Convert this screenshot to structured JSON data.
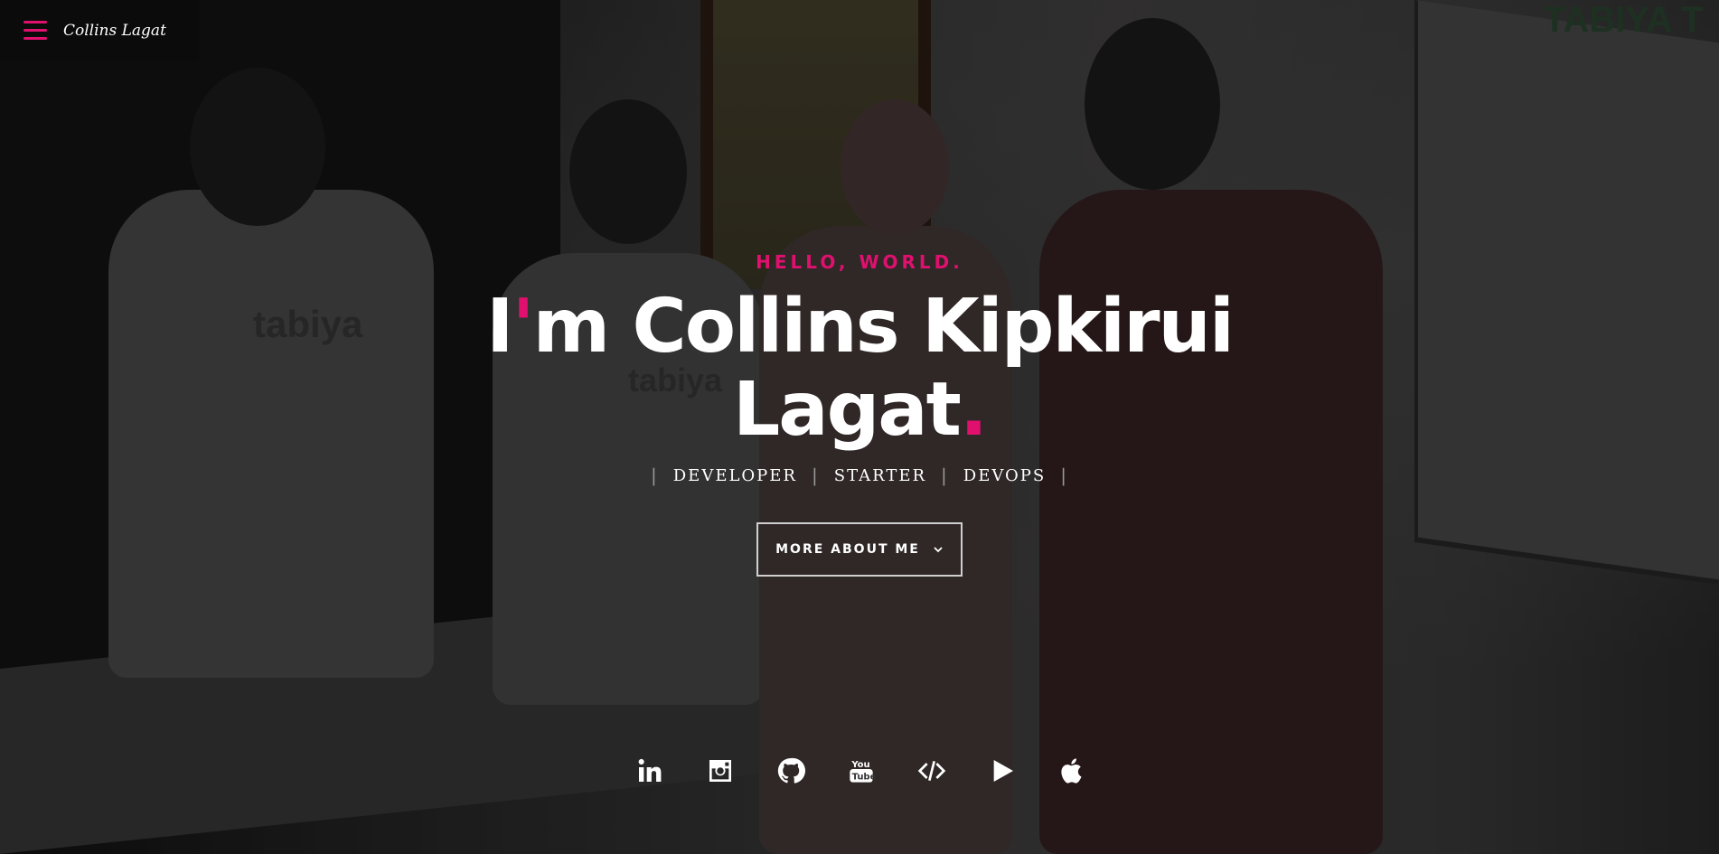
{
  "header": {
    "site_name": "Collins Lagat",
    "menu_icon": "hamburger-menu-icon",
    "accent_color": "#e0106f"
  },
  "hero": {
    "kicker": "HELLO, WORLD.",
    "title_apostrophe_prefix": "I",
    "title_apostrophe": "'",
    "title_rest": "m Collins Kipkirui Lagat",
    "title_dot": ".",
    "roles": [
      "DEVELOPER",
      "STARTER",
      "DEVOPS"
    ],
    "role_separator": "|",
    "more_button_label": "MORE ABOUT ME",
    "more_button_icon": "chevron-down-icon"
  },
  "background": {
    "screen_text": "TABIYA T",
    "shirt_text_1": "tabiya",
    "shirt_text_2": "tabiya"
  },
  "social": [
    {
      "name": "linkedin-icon"
    },
    {
      "name": "instagram-icon"
    },
    {
      "name": "github-icon"
    },
    {
      "name": "youtube-icon"
    },
    {
      "name": "code-icon"
    },
    {
      "name": "play-store-icon"
    },
    {
      "name": "apple-icon"
    }
  ]
}
